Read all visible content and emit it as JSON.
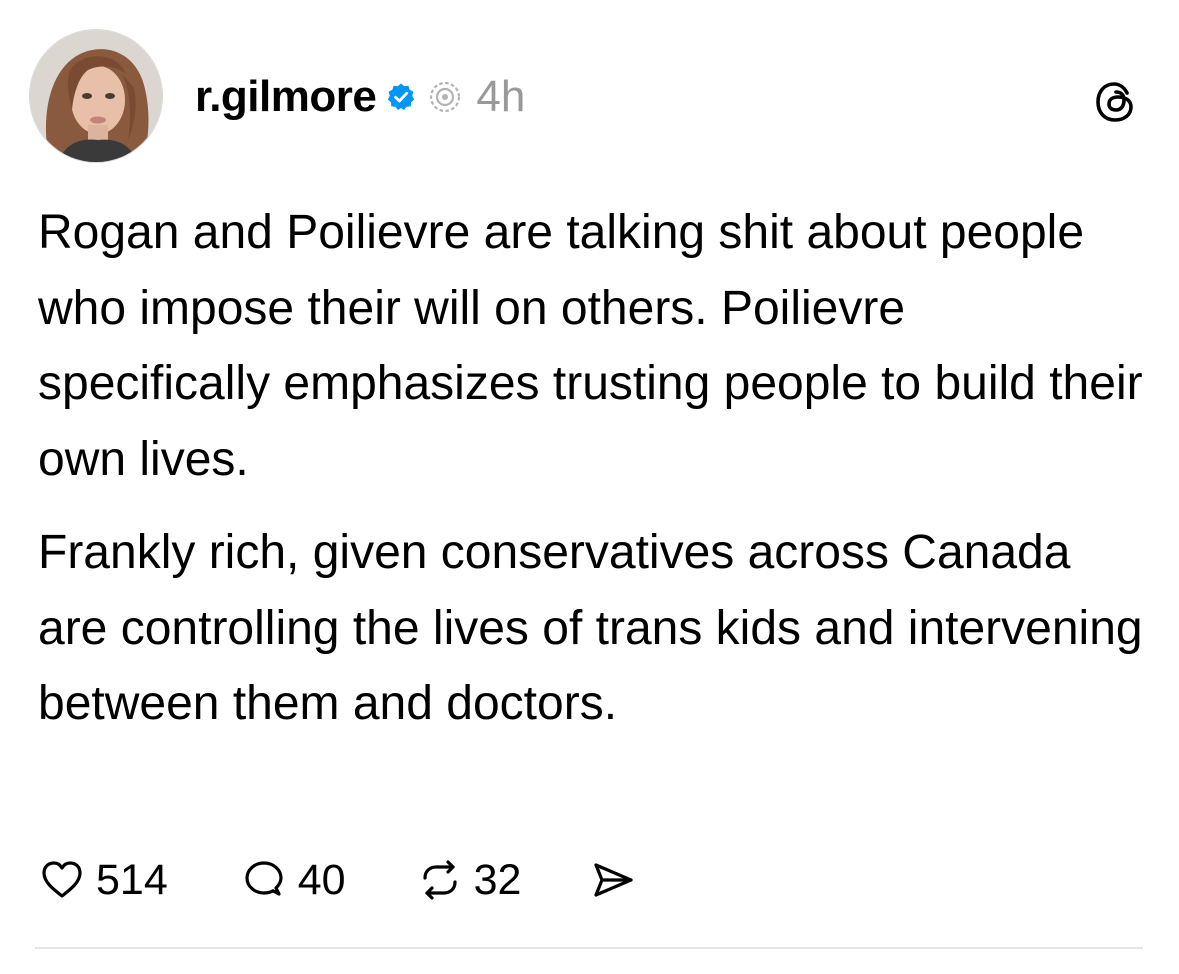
{
  "post": {
    "username": "r.gilmore",
    "time": "4h",
    "paragraphs": [
      "Rogan and Poilievre are talking shit about people who impose their will on others. Poilievre specifically emphasizes trusting people to build their own lives.",
      "Frankly rich, given conservatives across Canada are controlling the lives of trans kids and intervening between them and doctors."
    ],
    "counts": {
      "likes": "514",
      "replies": "40",
      "reposts": "32"
    },
    "icons": {
      "verified": "verified-badge-icon",
      "fediverse": "fediverse-icon",
      "logo": "threads-logo-icon",
      "like": "heart-icon",
      "reply": "comment-bubble-icon",
      "repost": "repost-icon",
      "share": "send-icon"
    },
    "colors": {
      "verified": "#0095f6",
      "muted": "#999999",
      "text": "#000000",
      "divider": "#e5e5e5"
    }
  }
}
